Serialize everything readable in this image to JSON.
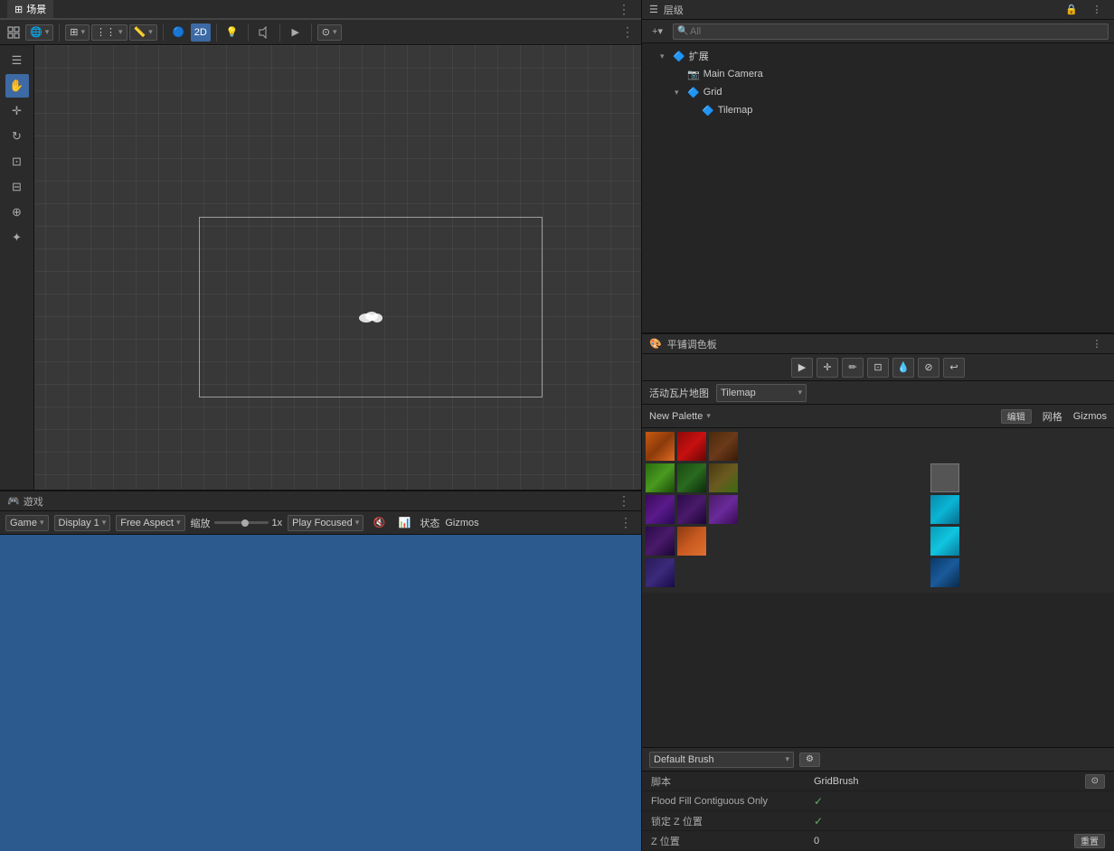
{
  "menubar": {
    "items": [
      "场景",
      "游戏"
    ]
  },
  "scene": {
    "tab_label": "场景",
    "toolbar": {
      "view_btn": "⊞",
      "globe_btn": "🌐",
      "mode_2d": "2D",
      "light_btn": "💡",
      "audio_btn": "🔊",
      "anim_btn": "▶",
      "more_btn": "⋮"
    }
  },
  "hierarchy": {
    "title": "层级",
    "search_placeholder": "All",
    "add_btn": "+",
    "more_btn": "⋮",
    "lock_btn": "🔒",
    "items": [
      {
        "label": "扩展",
        "level": 2,
        "expanded": true,
        "icon": "🔷"
      },
      {
        "label": "Main Camera",
        "level": 3,
        "icon": "📷"
      },
      {
        "label": "Grid",
        "level": 3,
        "expanded": true,
        "icon": "🔷"
      },
      {
        "label": "Tilemap",
        "level": 4,
        "icon": "🔷"
      }
    ]
  },
  "tile_palette": {
    "title": "平铺调色板",
    "more_btn": "⋮",
    "tools": [
      "▶",
      "⊕",
      "✏",
      "⊠",
      "⊙",
      "⊘",
      "↩"
    ],
    "active_tile_label": "活动瓦片地图",
    "tilemap_value": "Tilemap",
    "palette_name": "New Palette",
    "edit_btn": "编辑",
    "grid_btn": "网格",
    "gizmos_btn": "Gizmos"
  },
  "game": {
    "tab_label": "遊戏",
    "tab_icon": "🎮",
    "toolbar": {
      "game_label": "Game",
      "display_label": "Display 1",
      "aspect_label": "Free Aspect",
      "zoom_label": "缩放",
      "zoom_value": "1x",
      "play_focused_label": "Play Focused",
      "status_label": "状态",
      "gizmos_label": "Gizmos",
      "more_btn": "⋮"
    }
  },
  "brush": {
    "title": "Default Brush",
    "script_label": "脚本",
    "script_value": "GridBrush",
    "flood_fill_label": "Flood Fill Contiguous Only",
    "flood_fill_value": "✓",
    "lock_z_label": "锁定 Z 位置",
    "lock_z_value": "✓",
    "z_pos_label": "Z 位置",
    "z_pos_value": "0",
    "reset_btn": "重置"
  },
  "tiles": {
    "row1": [
      {
        "type": "orange",
        "col": 0
      },
      {
        "type": "red",
        "col": 1
      },
      {
        "type": "brown-dark",
        "col": 2
      }
    ],
    "row2": [
      {
        "type": "green",
        "col": 0
      },
      {
        "type": "green-dark",
        "col": 1
      },
      {
        "type": "brown-green",
        "col": 2
      }
    ],
    "row3": [
      {
        "type": "purple",
        "col": 0
      },
      {
        "type": "purple-dark",
        "col": 1
      },
      {
        "type": "purple-med",
        "col": 2
      }
    ],
    "row4": [
      {
        "type": "purple-dark",
        "col": 0
      },
      {
        "type": "fire",
        "col": 1
      }
    ]
  }
}
